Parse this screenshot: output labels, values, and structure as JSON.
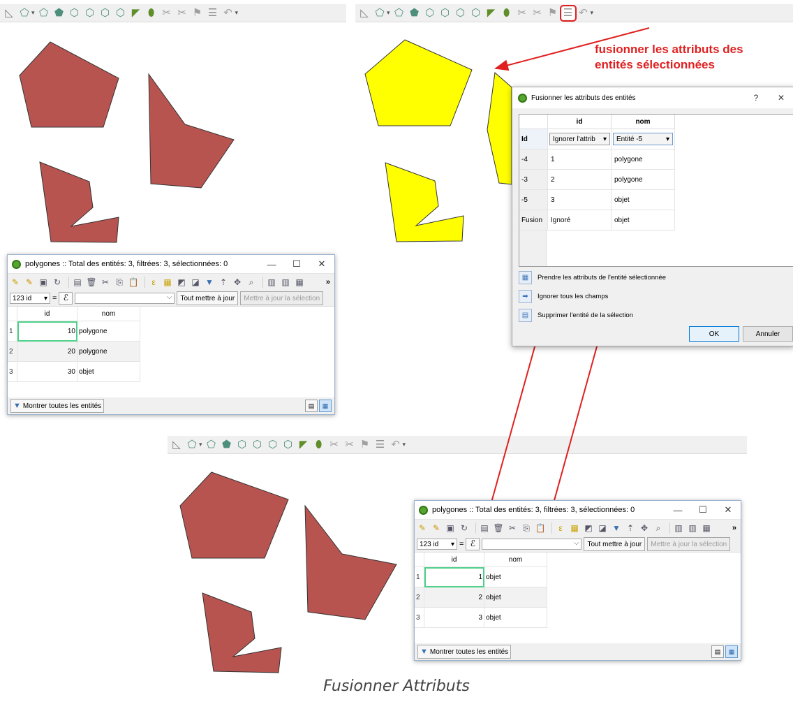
{
  "toolbar_icons": [
    "ruler-icon",
    "add-feature-icon",
    "reshape-icon",
    "split-icon",
    "fill-ring-icon",
    "add-ring-icon",
    "delete-ring-icon",
    "delete-part-icon",
    "offset-icon",
    "simplify-icon",
    "merge-features-icon",
    "split-parts-icon",
    "rotate-point-icon",
    "merge-attributes-icon",
    "trace-icon"
  ],
  "annotation": {
    "line1": "fusionner les attributs des",
    "line2": "entités sélectionnées",
    "color": "#e02020"
  },
  "colors": {
    "polygon_fill": "#b85450",
    "selected_fill": "#ffff00",
    "arrow": "#e02020",
    "current_cell": "#4fd08a"
  },
  "attr_table_before": {
    "title": "polygones :: Total des entités: 3, filtrées: 3, sélectionnées: 0",
    "field": "123 id",
    "update_all": "Tout mettre à jour",
    "update_selection": "Mettre à jour la sélection",
    "columns": [
      "id",
      "nom"
    ],
    "rows": [
      {
        "num": "1",
        "id": "10",
        "nom": "polygone"
      },
      {
        "num": "2",
        "id": "20",
        "nom": "polygone"
      },
      {
        "num": "3",
        "id": "30",
        "nom": "objet"
      }
    ],
    "show_all": "Montrer toutes les entités"
  },
  "attr_table_after": {
    "title": "polygones :: Total des entités: 3, filtrées: 3, sélectionnées: 0",
    "field": "123 id",
    "update_all": "Tout mettre à jour",
    "update_selection": "Mettre à jour la sélection",
    "columns": [
      "id",
      "nom"
    ],
    "rows": [
      {
        "num": "1",
        "id": "1",
        "nom": "objet"
      },
      {
        "num": "2",
        "id": "2",
        "nom": "objet"
      },
      {
        "num": "3",
        "id": "3",
        "nom": "objet"
      }
    ],
    "show_all": "Montrer toutes les entités"
  },
  "merge_dialog": {
    "title": "Fusionner les attributs des entités",
    "help": "?",
    "close": "✕",
    "columns": [
      "id",
      "nom"
    ],
    "id_row": {
      "header": "Id",
      "id_choice": "Ignorer l'attrib",
      "nom_choice": "Entité -5"
    },
    "rows": [
      {
        "header": "-4",
        "id": "1",
        "nom": "polygone"
      },
      {
        "header": "-3",
        "id": "2",
        "nom": "polygone"
      },
      {
        "header": "-5",
        "id": "3",
        "nom": "objet"
      },
      {
        "header": "Fusion",
        "id": "Ignoré",
        "nom": "objet"
      }
    ],
    "actions": [
      "Prendre les attributs de l'entité sélectionnée",
      "Ignorer tous les champs",
      "Supprimer l'entité de la sélection"
    ],
    "ok": "OK",
    "cancel": "Annuler"
  },
  "caption": "Fusionner Attributs"
}
